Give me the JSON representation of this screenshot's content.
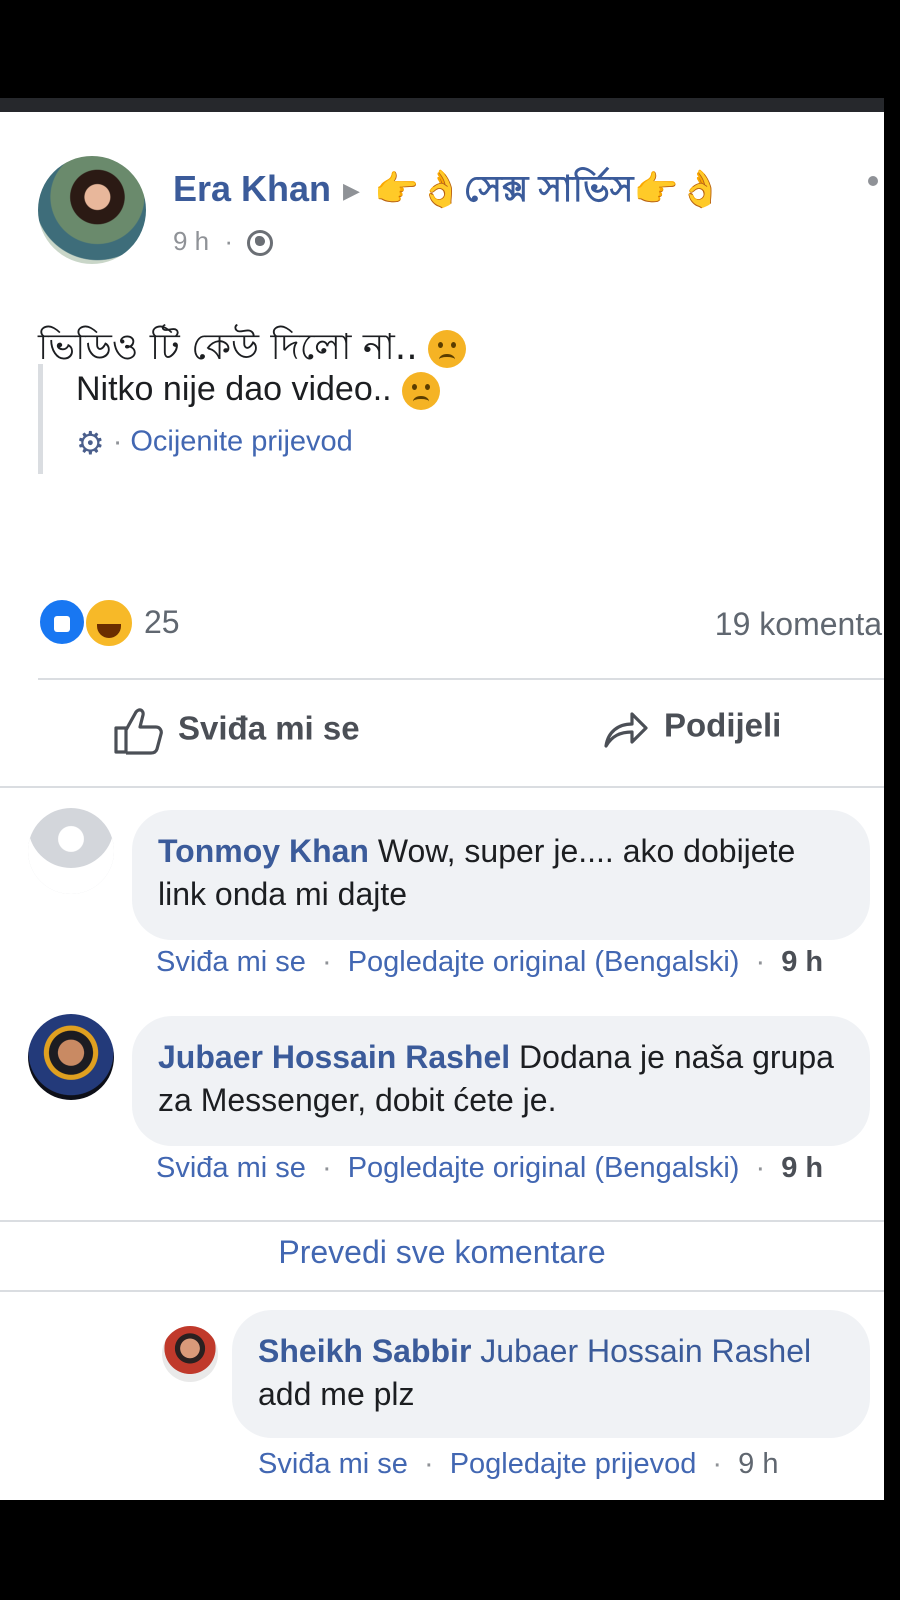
{
  "post": {
    "author": "Era Khan",
    "group": "👉👌সেক্স সার্ভিস👉👌",
    "time": "9 h",
    "text": "ভিডিও টি কেউ দিলো না..",
    "translation": "Nitko nije dao video..",
    "rate_translation": "Ocijenite prijevod",
    "reaction_count": "25",
    "comment_count": "19 komenta"
  },
  "actions": {
    "like": "Sviđa mi se",
    "share": "Podijeli"
  },
  "comments": [
    {
      "author": "Tonmoy Khan",
      "text": "Wow, super je.... ako dobijete link onda mi dajte",
      "like": "Sviđa mi se",
      "original": "Pogledajte original (Bengalski)",
      "time": "9 h"
    },
    {
      "author": "Jubaer Hossain Rashel",
      "text": "Dodana je naša grupa za Messenger, dobit ćete je.",
      "like": "Sviđa mi se",
      "original": "Pogledajte original (Bengalski)",
      "time": "9 h"
    }
  ],
  "translate_all": "Prevedi sve komentare",
  "reply": {
    "author": "Sheikh Sabbir",
    "mention": "Jubaer Hossain Rashel",
    "text": "add me plz",
    "like": "Sviđa mi se",
    "translate": "Pogledajte prijevod",
    "time": "9 h"
  },
  "colors": {
    "link_blue": "#4267b2",
    "name_blue": "#3b5b9a",
    "bubble_grey": "#f0f2f5"
  },
  "icons": [
    "globe-icon",
    "gear-icon",
    "like-reaction-icon",
    "haha-reaction-icon",
    "thumbs-up-icon",
    "share-arrow-icon",
    "more-icon"
  ]
}
